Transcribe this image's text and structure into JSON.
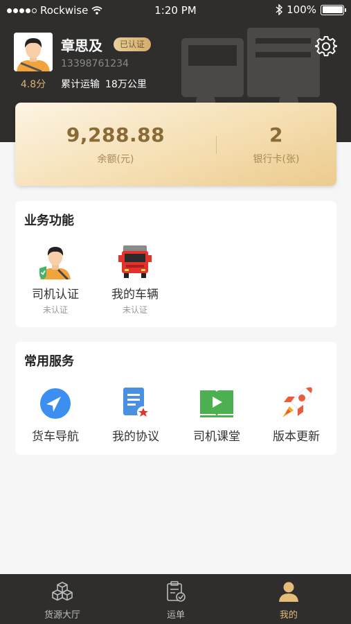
{
  "status_bar": {
    "carrier": "Rockwise",
    "time": "1:20 PM",
    "battery": "100%"
  },
  "profile": {
    "name": "章思及",
    "badge": "已认证",
    "phone": "13398761234",
    "rating": "4.8分",
    "mileage_label": "累计运输",
    "mileage_value": "18万公里"
  },
  "wallet": {
    "balance": "9,288.88",
    "balance_label": "余额(元)",
    "cards": "2",
    "cards_label": "银行卡(张)"
  },
  "business": {
    "title": "业务功能",
    "items": [
      {
        "label": "司机认证",
        "status": "未认证",
        "icon": "driver-avatar-check-icon"
      },
      {
        "label": "我的车辆",
        "status": "未认证",
        "icon": "red-truck-icon"
      }
    ]
  },
  "services": {
    "title": "常用服务",
    "items": [
      {
        "label": "货车导航",
        "icon": "navigation-arrow-icon"
      },
      {
        "label": "我的协议",
        "icon": "document-star-icon"
      },
      {
        "label": "司机课堂",
        "icon": "book-play-icon"
      },
      {
        "label": "版本更新",
        "icon": "rocket-icon"
      }
    ]
  },
  "tabbar": {
    "tabs": [
      {
        "label": "货源大厅",
        "icon": "cubes-icon"
      },
      {
        "label": "运单",
        "icon": "clipboard-check-icon"
      },
      {
        "label": "我的",
        "icon": "person-icon"
      }
    ],
    "active": "我的"
  },
  "colors": {
    "header_bg": "#2f2e2d",
    "gold": "#d7b271",
    "accent_active": "#e3bd79"
  }
}
